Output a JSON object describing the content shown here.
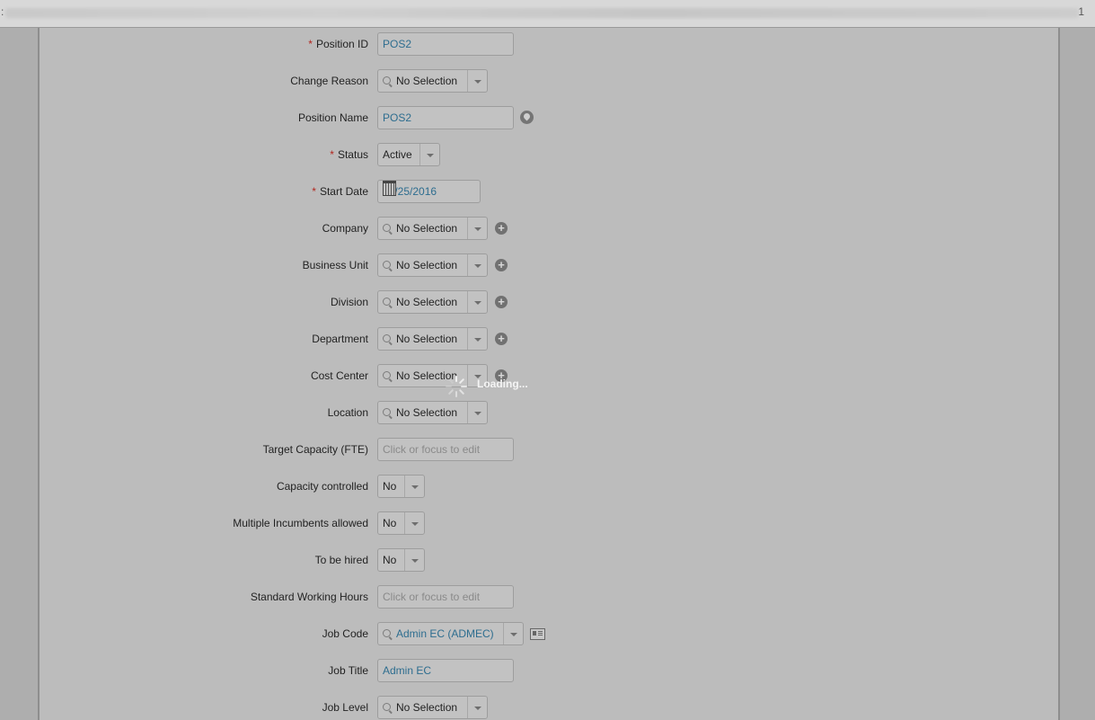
{
  "topbar": {
    "right_mark": "1",
    "left_mark": ":"
  },
  "form": {
    "position_id": {
      "label": "Position ID",
      "value": "POS2"
    },
    "change_reason": {
      "label": "Change Reason",
      "value": "No Selection"
    },
    "position_name": {
      "label": "Position Name",
      "value": "POS2"
    },
    "status": {
      "label": "Status",
      "value": "Active"
    },
    "start_date": {
      "label": "Start Date",
      "value": "08/25/2016"
    },
    "company": {
      "label": "Company",
      "value": "No Selection"
    },
    "business_unit": {
      "label": "Business Unit",
      "value": "No Selection"
    },
    "division": {
      "label": "Division",
      "value": "No Selection"
    },
    "department": {
      "label": "Department",
      "value": "No Selection"
    },
    "cost_center": {
      "label": "Cost Center",
      "value": "No Selection"
    },
    "location": {
      "label": "Location",
      "value": "No Selection"
    },
    "target_capacity": {
      "label": "Target Capacity (FTE)",
      "placeholder": "Click or focus to edit"
    },
    "capacity_controlled": {
      "label": "Capacity controlled",
      "value": "No"
    },
    "multiple_incumbents": {
      "label": "Multiple Incumbents allowed",
      "value": "No"
    },
    "to_be_hired": {
      "label": "To be hired",
      "value": "No"
    },
    "standard_hours": {
      "label": "Standard Working Hours",
      "placeholder": "Click or focus to edit"
    },
    "job_code": {
      "label": "Job Code",
      "value": "Admin EC (ADMEC)"
    },
    "job_title": {
      "label": "Job Title",
      "value": "Admin EC"
    },
    "job_level": {
      "label": "Job Level",
      "value": "No Selection"
    }
  },
  "required_marker": "*",
  "loading": {
    "text": "Loading..."
  },
  "icons": {
    "plus": "+"
  }
}
